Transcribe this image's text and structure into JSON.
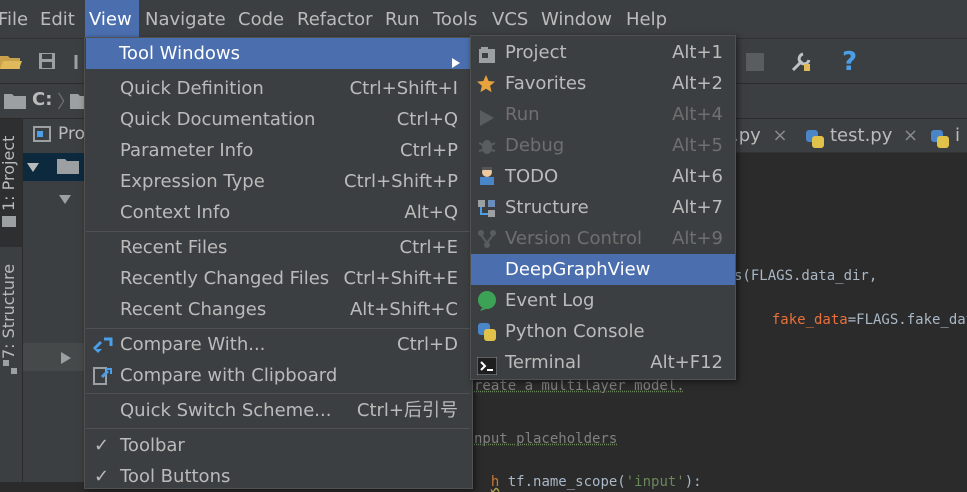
{
  "menubar": {
    "items": [
      "File",
      "Edit",
      "View",
      "Navigate",
      "Code",
      "Refactor",
      "Run",
      "Tools",
      "VCS",
      "Window",
      "Help"
    ]
  },
  "navbar": {
    "drive": "C:"
  },
  "project_panel": {
    "header": "Pro"
  },
  "side_tabs": {
    "project": "1: Project",
    "structure": "7: Structure"
  },
  "editor_tabs": [
    ".py",
    "test.py",
    "i"
  ],
  "code_lines": {
    "line1_prefix": "s(FLAGS.data_dir,",
    "line2_param": "fake_data",
    "line2_rest": "=FLAGS.fake_dat",
    "line3": "reate a multilayer model.",
    "line4": "nput placeholders",
    "line5_kw": "h",
    "line5_a": " tf.name_scope(",
    "line5_str": "'input'",
    "line5_b": "):"
  },
  "view_menu": {
    "items": [
      {
        "label": "Tool Windows",
        "shortcut": "",
        "submenu": true
      },
      {
        "label": "Quick Definition",
        "shortcut": "Ctrl+Shift+I"
      },
      {
        "label": "Quick Documentation",
        "shortcut": "Ctrl+Q"
      },
      {
        "label": "Parameter Info",
        "shortcut": "Ctrl+P"
      },
      {
        "label": "Expression Type",
        "shortcut": "Ctrl+Shift+P"
      },
      {
        "label": "Context Info",
        "shortcut": "Alt+Q"
      },
      {
        "label": "Recent Files",
        "shortcut": "Ctrl+E"
      },
      {
        "label": "Recently Changed Files",
        "shortcut": "Ctrl+Shift+E"
      },
      {
        "label": "Recent Changes",
        "shortcut": "Alt+Shift+C"
      },
      {
        "label": "Compare With...",
        "shortcut": "Ctrl+D"
      },
      {
        "label": "Compare with Clipboard",
        "shortcut": ""
      },
      {
        "label": "Quick Switch Scheme...",
        "shortcut": "Ctrl+后引号"
      },
      {
        "label": "Toolbar",
        "shortcut": "",
        "checked": true
      },
      {
        "label": "Tool Buttons",
        "shortcut": "",
        "checked": true
      }
    ]
  },
  "tool_windows_menu": {
    "items": [
      {
        "label": "Project",
        "shortcut": "Alt+1",
        "icon": "project-icon"
      },
      {
        "label": "Favorites",
        "shortcut": "Alt+2",
        "icon": "star-icon"
      },
      {
        "label": "Run",
        "shortcut": "Alt+4",
        "icon": "run-icon",
        "disabled": true
      },
      {
        "label": "Debug",
        "shortcut": "Alt+5",
        "icon": "debug-icon",
        "disabled": true
      },
      {
        "label": "TODO",
        "shortcut": "Alt+6",
        "icon": "todo-icon"
      },
      {
        "label": "Structure",
        "shortcut": "Alt+7",
        "icon": "structure-icon"
      },
      {
        "label": "Version Control",
        "shortcut": "Alt+9",
        "icon": "vcs-icon",
        "disabled": true
      },
      {
        "label": "DeepGraphView",
        "shortcut": "",
        "selected": true
      },
      {
        "label": "Event Log",
        "shortcut": "",
        "icon": "event-log-icon"
      },
      {
        "label": "Python Console",
        "shortcut": "",
        "icon": "python-icon"
      },
      {
        "label": "Terminal",
        "shortcut": "Alt+F12",
        "icon": "terminal-icon"
      }
    ]
  },
  "colors": {
    "menu_bg": "#3c3f41",
    "selection": "#4b6eaf",
    "editor_bg": "#2b2b2b",
    "disabled_text": "#6f6f6f",
    "param_color": "#e8703a",
    "string_color": "#6a8759",
    "comment_color": "#808080"
  }
}
